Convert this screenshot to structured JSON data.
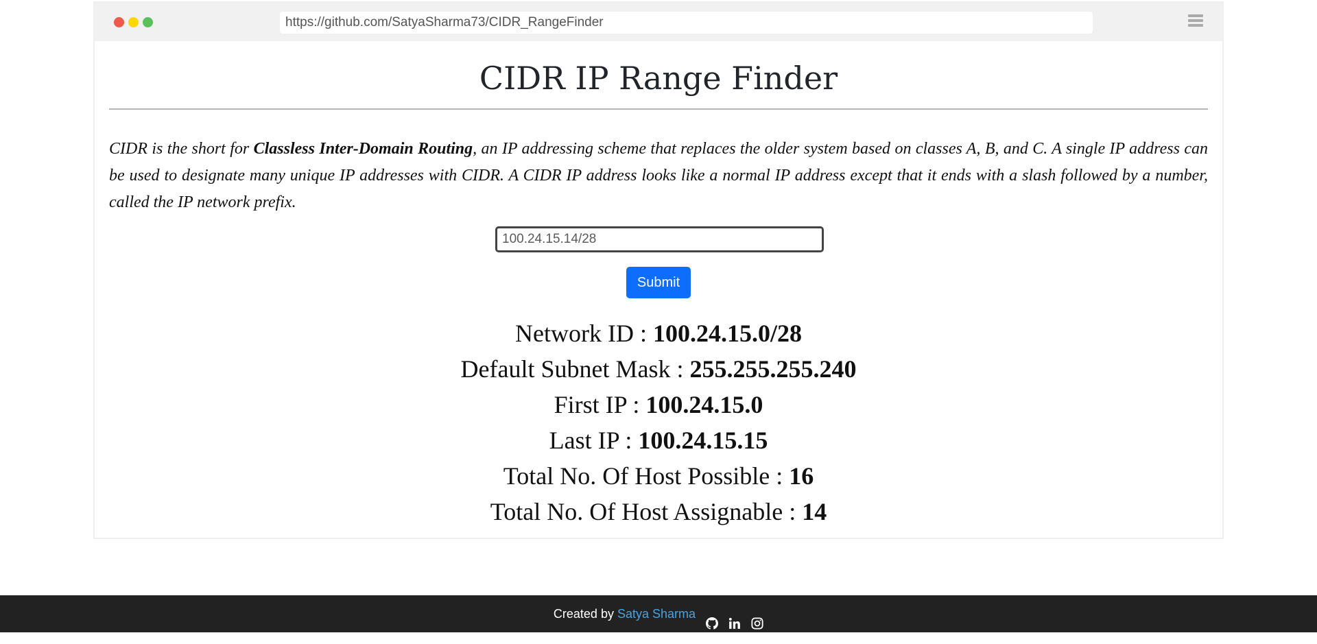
{
  "browser": {
    "url": "https://github.com/SatyaSharma73/CIDR_RangeFinder",
    "icons": [
      "close-dot",
      "minimize-dot",
      "maximize-dot",
      "menu-icon"
    ]
  },
  "page": {
    "title": "CIDR IP Range Finder",
    "description": {
      "intro": "CIDR is the short for ",
      "bold": "Classless Inter-Domain Routing",
      "rest": ", an IP addressing scheme that replaces the older system based on classes A, B, and C. A single IP address can be used to designate many unique IP addresses with CIDR. A CIDR IP address looks like a normal IP address except that it ends with a slash followed by a number, called the IP network prefix."
    },
    "input": {
      "value": "100.24.15.14/28"
    },
    "submit_label": "Submit",
    "results": [
      {
        "label": "Network ID : ",
        "value": "100.24.15.0/28"
      },
      {
        "label": "Default Subnet Mask : ",
        "value": "255.255.255.240"
      },
      {
        "label": "First IP : ",
        "value": "100.24.15.0"
      },
      {
        "label": "Last IP : ",
        "value": "100.24.15.15"
      },
      {
        "label": "Total No. Of Host Possible : ",
        "value": "16"
      },
      {
        "label": "Total No. Of Host Assignable : ",
        "value": "14"
      }
    ]
  },
  "footer": {
    "created_by": "Created by ",
    "author": "Satya Sharma",
    "icons": [
      "github-icon",
      "linkedin-icon",
      "instagram-icon"
    ]
  },
  "colors": {
    "accent": "#0d6efd",
    "footer_bg": "#222222",
    "author_link": "#4aa3df"
  }
}
